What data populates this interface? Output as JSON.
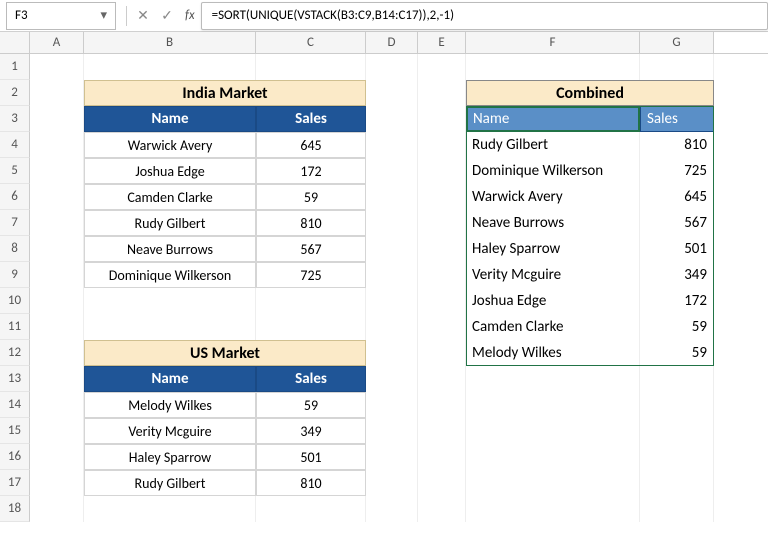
{
  "nameBox": "F3",
  "fxLabel": "fx",
  "formula": "=SORT(UNIQUE(VSTACK(B3:C9,B14:C17)),2,-1)",
  "columns": [
    "A",
    "B",
    "C",
    "D",
    "E",
    "F",
    "G"
  ],
  "rows": [
    "1",
    "2",
    "3",
    "4",
    "5",
    "6",
    "7",
    "8",
    "9",
    "10",
    "11",
    "12",
    "13",
    "14",
    "15",
    "16",
    "17",
    "18"
  ],
  "indiaTitle": "India Market",
  "nameHeader": "Name",
  "salesHeader": "Sales",
  "india": [
    {
      "name": "Warwick Avery",
      "sales": "645"
    },
    {
      "name": "Joshua Edge",
      "sales": "172"
    },
    {
      "name": "Camden Clarke",
      "sales": "59"
    },
    {
      "name": "Rudy Gilbert",
      "sales": "810"
    },
    {
      "name": "Neave Burrows",
      "sales": "567"
    },
    {
      "name": "Dominique Wilkerson",
      "sales": "725"
    }
  ],
  "usTitle": "US Market",
  "us": [
    {
      "name": "Melody Wilkes",
      "sales": "59"
    },
    {
      "name": "Verity Mcguire",
      "sales": "349"
    },
    {
      "name": "Haley Sparrow",
      "sales": "501"
    },
    {
      "name": "Rudy Gilbert",
      "sales": "810"
    }
  ],
  "combinedTitle": "Combined",
  "combined": [
    {
      "name": "Name",
      "sales": "Sales"
    },
    {
      "name": "Rudy Gilbert",
      "sales": "810"
    },
    {
      "name": "Dominique Wilkerson",
      "sales": "725"
    },
    {
      "name": "Warwick Avery",
      "sales": "645"
    },
    {
      "name": "Neave Burrows",
      "sales": "567"
    },
    {
      "name": "Haley Sparrow",
      "sales": "501"
    },
    {
      "name": "Verity Mcguire",
      "sales": "349"
    },
    {
      "name": "Joshua Edge",
      "sales": "172"
    },
    {
      "name": "Camden Clarke",
      "sales": "59"
    },
    {
      "name": "Melody Wilkes",
      "sales": "59"
    }
  ]
}
